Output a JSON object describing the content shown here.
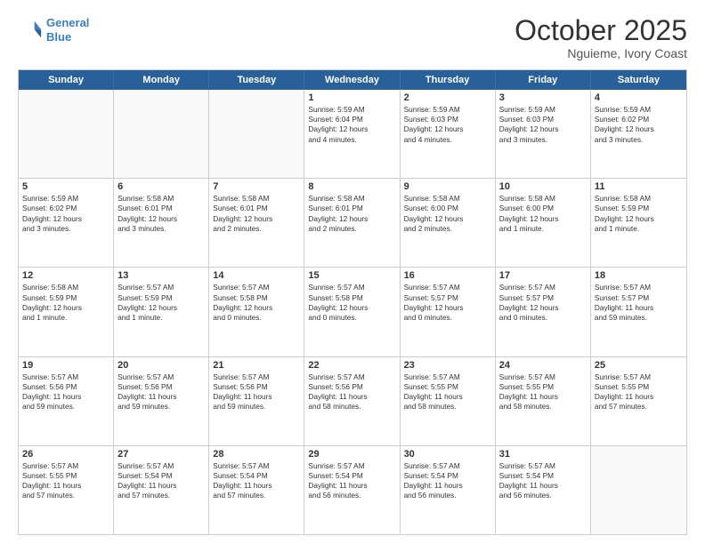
{
  "header": {
    "logo_line1": "General",
    "logo_line2": "Blue",
    "month": "October 2025",
    "location": "Nguieme, Ivory Coast"
  },
  "weekdays": [
    "Sunday",
    "Monday",
    "Tuesday",
    "Wednesday",
    "Thursday",
    "Friday",
    "Saturday"
  ],
  "rows": [
    [
      {
        "day": "",
        "lines": []
      },
      {
        "day": "",
        "lines": []
      },
      {
        "day": "",
        "lines": []
      },
      {
        "day": "1",
        "lines": [
          "Sunrise: 5:59 AM",
          "Sunset: 6:04 PM",
          "Daylight: 12 hours",
          "and 4 minutes."
        ]
      },
      {
        "day": "2",
        "lines": [
          "Sunrise: 5:59 AM",
          "Sunset: 6:03 PM",
          "Daylight: 12 hours",
          "and 4 minutes."
        ]
      },
      {
        "day": "3",
        "lines": [
          "Sunrise: 5:59 AM",
          "Sunset: 6:03 PM",
          "Daylight: 12 hours",
          "and 3 minutes."
        ]
      },
      {
        "day": "4",
        "lines": [
          "Sunrise: 5:59 AM",
          "Sunset: 6:02 PM",
          "Daylight: 12 hours",
          "and 3 minutes."
        ]
      }
    ],
    [
      {
        "day": "5",
        "lines": [
          "Sunrise: 5:59 AM",
          "Sunset: 6:02 PM",
          "Daylight: 12 hours",
          "and 3 minutes."
        ]
      },
      {
        "day": "6",
        "lines": [
          "Sunrise: 5:58 AM",
          "Sunset: 6:01 PM",
          "Daylight: 12 hours",
          "and 3 minutes."
        ]
      },
      {
        "day": "7",
        "lines": [
          "Sunrise: 5:58 AM",
          "Sunset: 6:01 PM",
          "Daylight: 12 hours",
          "and 2 minutes."
        ]
      },
      {
        "day": "8",
        "lines": [
          "Sunrise: 5:58 AM",
          "Sunset: 6:01 PM",
          "Daylight: 12 hours",
          "and 2 minutes."
        ]
      },
      {
        "day": "9",
        "lines": [
          "Sunrise: 5:58 AM",
          "Sunset: 6:00 PM",
          "Daylight: 12 hours",
          "and 2 minutes."
        ]
      },
      {
        "day": "10",
        "lines": [
          "Sunrise: 5:58 AM",
          "Sunset: 6:00 PM",
          "Daylight: 12 hours",
          "and 1 minute."
        ]
      },
      {
        "day": "11",
        "lines": [
          "Sunrise: 5:58 AM",
          "Sunset: 5:59 PM",
          "Daylight: 12 hours",
          "and 1 minute."
        ]
      }
    ],
    [
      {
        "day": "12",
        "lines": [
          "Sunrise: 5:58 AM",
          "Sunset: 5:59 PM",
          "Daylight: 12 hours",
          "and 1 minute."
        ]
      },
      {
        "day": "13",
        "lines": [
          "Sunrise: 5:57 AM",
          "Sunset: 5:59 PM",
          "Daylight: 12 hours",
          "and 1 minute."
        ]
      },
      {
        "day": "14",
        "lines": [
          "Sunrise: 5:57 AM",
          "Sunset: 5:58 PM",
          "Daylight: 12 hours",
          "and 0 minutes."
        ]
      },
      {
        "day": "15",
        "lines": [
          "Sunrise: 5:57 AM",
          "Sunset: 5:58 PM",
          "Daylight: 12 hours",
          "and 0 minutes."
        ]
      },
      {
        "day": "16",
        "lines": [
          "Sunrise: 5:57 AM",
          "Sunset: 5:57 PM",
          "Daylight: 12 hours",
          "and 0 minutes."
        ]
      },
      {
        "day": "17",
        "lines": [
          "Sunrise: 5:57 AM",
          "Sunset: 5:57 PM",
          "Daylight: 12 hours",
          "and 0 minutes."
        ]
      },
      {
        "day": "18",
        "lines": [
          "Sunrise: 5:57 AM",
          "Sunset: 5:57 PM",
          "Daylight: 11 hours",
          "and 59 minutes."
        ]
      }
    ],
    [
      {
        "day": "19",
        "lines": [
          "Sunrise: 5:57 AM",
          "Sunset: 5:56 PM",
          "Daylight: 11 hours",
          "and 59 minutes."
        ]
      },
      {
        "day": "20",
        "lines": [
          "Sunrise: 5:57 AM",
          "Sunset: 5:56 PM",
          "Daylight: 11 hours",
          "and 59 minutes."
        ]
      },
      {
        "day": "21",
        "lines": [
          "Sunrise: 5:57 AM",
          "Sunset: 5:56 PM",
          "Daylight: 11 hours",
          "and 59 minutes."
        ]
      },
      {
        "day": "22",
        "lines": [
          "Sunrise: 5:57 AM",
          "Sunset: 5:56 PM",
          "Daylight: 11 hours",
          "and 58 minutes."
        ]
      },
      {
        "day": "23",
        "lines": [
          "Sunrise: 5:57 AM",
          "Sunset: 5:55 PM",
          "Daylight: 11 hours",
          "and 58 minutes."
        ]
      },
      {
        "day": "24",
        "lines": [
          "Sunrise: 5:57 AM",
          "Sunset: 5:55 PM",
          "Daylight: 11 hours",
          "and 58 minutes."
        ]
      },
      {
        "day": "25",
        "lines": [
          "Sunrise: 5:57 AM",
          "Sunset: 5:55 PM",
          "Daylight: 11 hours",
          "and 57 minutes."
        ]
      }
    ],
    [
      {
        "day": "26",
        "lines": [
          "Sunrise: 5:57 AM",
          "Sunset: 5:55 PM",
          "Daylight: 11 hours",
          "and 57 minutes."
        ]
      },
      {
        "day": "27",
        "lines": [
          "Sunrise: 5:57 AM",
          "Sunset: 5:54 PM",
          "Daylight: 11 hours",
          "and 57 minutes."
        ]
      },
      {
        "day": "28",
        "lines": [
          "Sunrise: 5:57 AM",
          "Sunset: 5:54 PM",
          "Daylight: 11 hours",
          "and 57 minutes."
        ]
      },
      {
        "day": "29",
        "lines": [
          "Sunrise: 5:57 AM",
          "Sunset: 5:54 PM",
          "Daylight: 11 hours",
          "and 56 minutes."
        ]
      },
      {
        "day": "30",
        "lines": [
          "Sunrise: 5:57 AM",
          "Sunset: 5:54 PM",
          "Daylight: 11 hours",
          "and 56 minutes."
        ]
      },
      {
        "day": "31",
        "lines": [
          "Sunrise: 5:57 AM",
          "Sunset: 5:54 PM",
          "Daylight: 11 hours",
          "and 56 minutes."
        ]
      },
      {
        "day": "",
        "lines": []
      }
    ]
  ]
}
